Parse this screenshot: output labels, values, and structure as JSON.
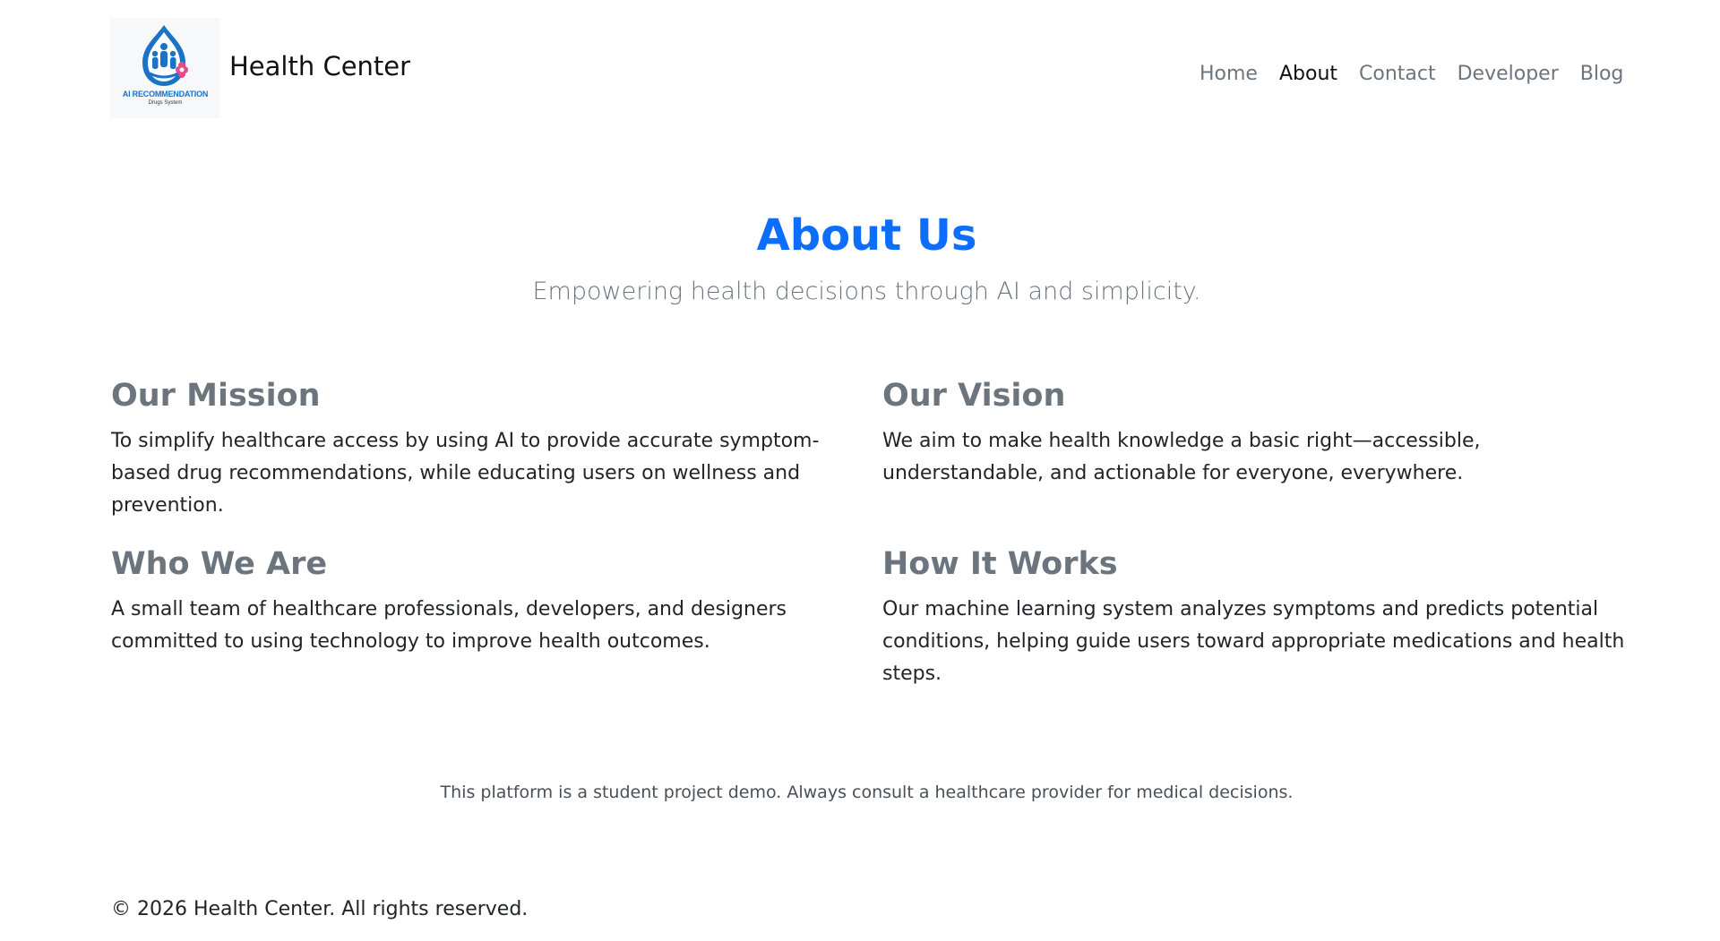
{
  "brand": {
    "name": "Health Center",
    "logo_text_line1": "AI RECOMMENDATION",
    "logo_text_line2": "Drugs System",
    "logo_icon": "family-droplet-icon"
  },
  "nav": {
    "items": [
      {
        "label": "Home",
        "active": false
      },
      {
        "label": "About",
        "active": true
      },
      {
        "label": "Contact",
        "active": false
      },
      {
        "label": "Developer",
        "active": false
      },
      {
        "label": "Blog",
        "active": false
      }
    ]
  },
  "hero": {
    "title": "About Us",
    "subtitle": "Empowering health decisions through AI and simplicity."
  },
  "sections": {
    "mission": {
      "heading": "Our Mission",
      "body": "To simplify healthcare access by using AI to provide accurate symptom-based drug recommendations, while educating users on wellness and prevention."
    },
    "vision": {
      "heading": "Our Vision",
      "body": "We aim to make health knowledge a basic right—accessible, understandable, and actionable for everyone, everywhere."
    },
    "who": {
      "heading": "Who We Are",
      "body": "A small team of healthcare professionals, developers, and designers committed to using technology to improve health outcomes."
    },
    "how": {
      "heading": "How It Works",
      "body": "Our machine learning system analyzes symptoms and predicts potential conditions, helping guide users toward appropriate medications and health steps."
    }
  },
  "disclaimer": "This platform is a student project demo. Always consult a healthcare provider for medical decisions.",
  "footer": {
    "copyright": "© 2026 Health Center. All rights reserved."
  },
  "colors": {
    "accent": "#0d6efd",
    "muted": "#6c757d",
    "text": "#212529",
    "logo_blue": "#1a73c4",
    "logo_pink": "#e84a8a"
  }
}
